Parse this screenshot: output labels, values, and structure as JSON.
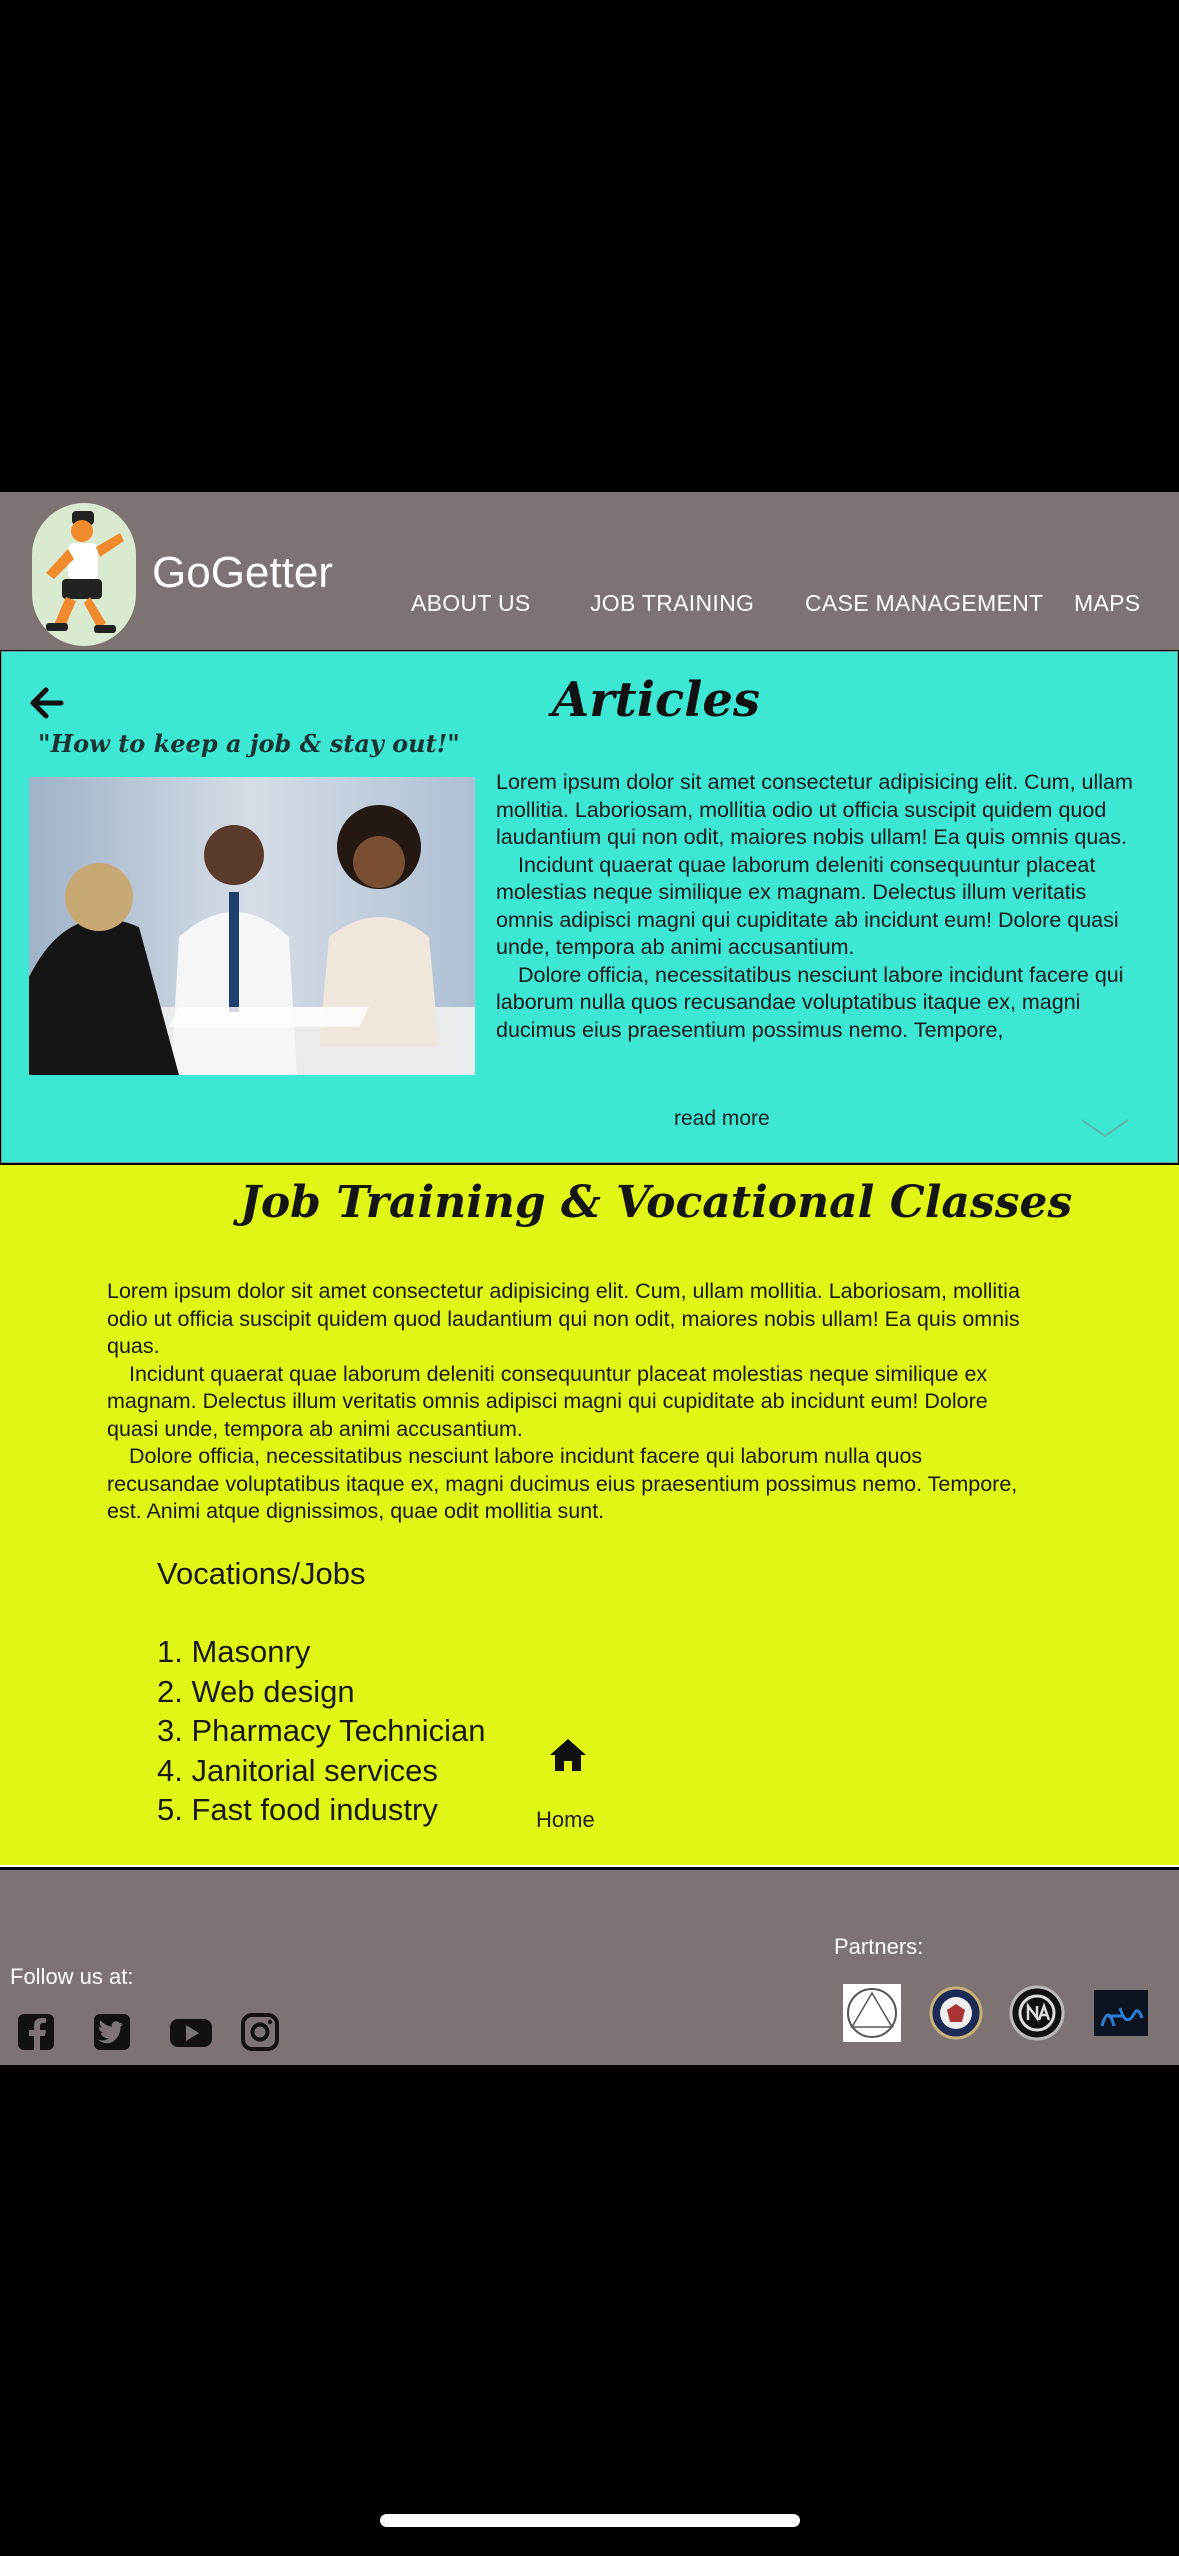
{
  "header": {
    "brand": "GoGetter",
    "nav": [
      "ABOUT US",
      "JOB TRAINING",
      "CASE MANAGEMENT",
      "MAPS"
    ]
  },
  "articles": {
    "title": "Articles",
    "subtitle": "\"How to keep a job & stay out!\"",
    "paragraphs": [
      "Lorem ipsum dolor sit amet consectetur adipisicing elit. Cum, ullam mollitia. Laboriosam, mollitia odio ut officia suscipit quidem quod laudantium qui non odit, maiores nobis ullam! Ea quis omnis quas.",
      "Incidunt quaerat quae laborum deleniti consequuntur placeat molestias neque similique ex magnam. Delectus illum veritatis omnis adipisci magni qui cupiditate ab incidunt eum! Dolore quasi unde, tempora ab animi accusantium.",
      "Dolore officia, necessitatibus nesciunt labore incidunt facere qui laborum nulla quos recusandae voluptatibus itaque ex, magni ducimus eius praesentium possimus nemo. Tempore,"
    ],
    "read_more": "read more"
  },
  "jobs": {
    "title": "Job Training & Vocational Classes",
    "paragraphs": [
      "Lorem ipsum dolor sit amet consectetur adipisicing elit. Cum, ullam mollitia. Laboriosam, mollitia odio ut officia suscipit quidem quod laudantium qui non odit, maiores nobis ullam! Ea quis omnis quas.",
      "Incidunt quaerat quae laborum deleniti consequuntur placeat molestias neque similique ex magnam. Delectus illum veritatis omnis adipisci magni qui cupiditate ab incidunt eum! Dolore quasi unde, tempora ab animi accusantium.",
      "Dolore officia, necessitatibus nesciunt labore incidunt facere qui laborum nulla quos recusandae voluptatibus itaque ex, magni ducimus eius praesentium possimus nemo. Tempore, est. Animi atque dignissimos, quae odit mollitia sunt."
    ],
    "vocations_heading": "Vocations/Jobs",
    "vocations": [
      "1. Masonry",
      "2. Web design",
      "3. Pharmacy Technician",
      "4. Janitorial services",
      "5. Fast food industry"
    ],
    "home_label": "Home"
  },
  "footer": {
    "follow_label": "Follow us at:",
    "social_icons": [
      "facebook-icon",
      "twitter-icon",
      "youtube-icon",
      "instagram-icon"
    ],
    "partners_label": "Partners:",
    "partner_logos": [
      "aa-logo",
      "va-seal-logo",
      "na-logo",
      "hope-logo"
    ]
  },
  "colors": {
    "header_bg": "#7d7372",
    "articles_bg": "#3ce8d4",
    "jobs_bg": "#e0f614",
    "logo_skin": "#f08a2c"
  }
}
